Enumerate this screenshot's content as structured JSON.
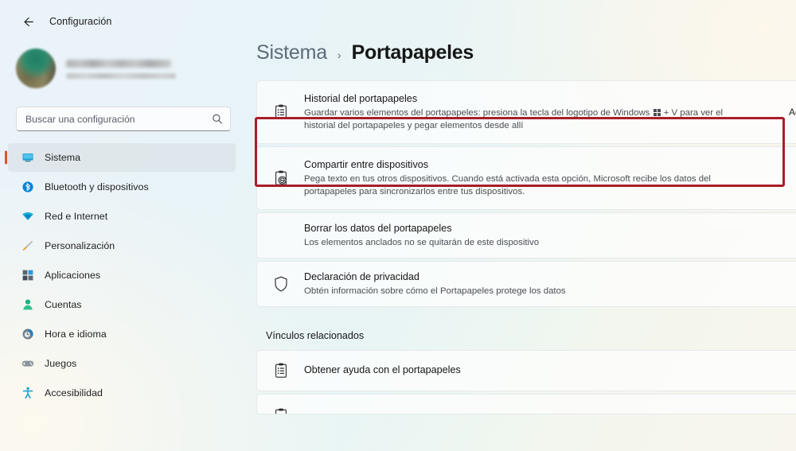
{
  "window": {
    "back_label": "back-arrow",
    "app_title": "Configuración"
  },
  "sidebar": {
    "account": {
      "name_redacted": "",
      "email_redacted": ""
    },
    "search": {
      "placeholder": "Buscar una configuración",
      "value": "",
      "icon": "search-icon"
    },
    "items": [
      {
        "label": "Sistema",
        "icon": "display-icon",
        "selected": true
      },
      {
        "label": "Bluetooth y dispositivos",
        "icon": "bluetooth-icon",
        "selected": false
      },
      {
        "label": "Red e Internet",
        "icon": "wifi-icon",
        "selected": false
      },
      {
        "label": "Personalización",
        "icon": "paintbrush-icon",
        "selected": false
      },
      {
        "label": "Aplicaciones",
        "icon": "apps-icon",
        "selected": false
      },
      {
        "label": "Cuentas",
        "icon": "person-icon",
        "selected": false
      },
      {
        "label": "Hora e idioma",
        "icon": "clock-icon",
        "selected": false
      },
      {
        "label": "Juegos",
        "icon": "gamepad-icon",
        "selected": false
      },
      {
        "label": "Accesibilidad",
        "icon": "accessibility-icon",
        "selected": false
      }
    ]
  },
  "main": {
    "breadcrumb": {
      "parent": "Sistema",
      "separator": "›",
      "current": "Portapapeles"
    },
    "cards": [
      {
        "title": "Historial del portapapeles",
        "desc_before": "Guardar varios elementos del portapapeles: presiona la tecla del logotipo de Windows ",
        "desc_after": " + V para ver el historial del portapapeles y pegar elementos desde allí",
        "icon": "clipboard-list-icon",
        "right_label": "Ac"
      },
      {
        "title": "Compartir entre dispositivos",
        "desc": "Pega texto en tus otros dispositivos. Cuando está activada esta opción, Microsoft recibe los datos del portapapeles para sincronizarlos entre tus dispositivos.",
        "icon": "clipboard-sync-icon",
        "highlighted": true
      },
      {
        "title": "Borrar los datos del portapapeles",
        "desc": "Los elementos anclados no se quitarán de este dispositivo",
        "icon": "none"
      },
      {
        "title": "Declaración de privacidad",
        "desc": "Obtén información sobre cómo el Portapapeles protege los datos",
        "icon": "shield-icon"
      }
    ],
    "related": {
      "section_title": "Vínculos relacionados",
      "links": [
        {
          "title": "Obtener ayuda con el portapapeles",
          "icon": "clipboard-list-icon"
        }
      ]
    }
  },
  "colors": {
    "accent_selected": "#d9542b",
    "highlight_box": "#a81e28",
    "title_text": "#161616",
    "desc_text": "#4a4f54"
  }
}
